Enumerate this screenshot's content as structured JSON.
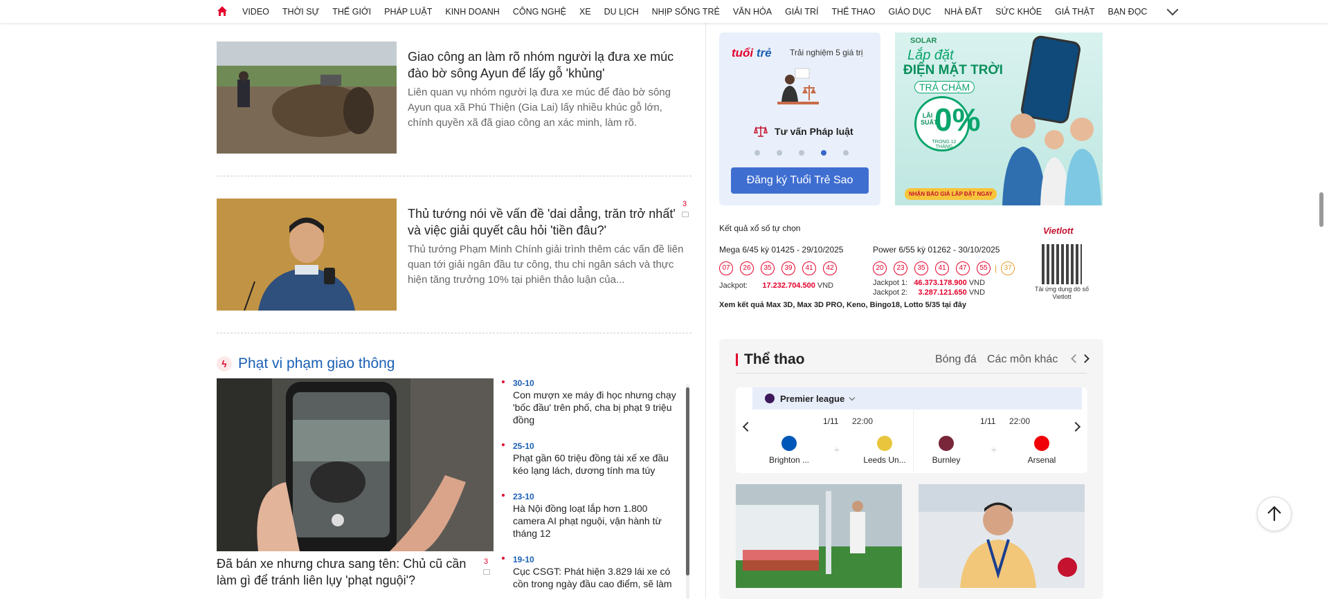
{
  "nav": {
    "items": [
      "VIDEO",
      "THỜI SỰ",
      "THẾ GIỚI",
      "PHÁP LUẬT",
      "KINH DOANH",
      "CÔNG NGHỆ",
      "XE",
      "DU LỊCH",
      "NHỊP SỐNG TRẺ",
      "VĂN HÓA",
      "GIẢI TRÍ",
      "THỂ THAO",
      "GIÁO DỤC",
      "NHÀ ĐẤT",
      "SỨC KHỎE",
      "GIẢ THẬT",
      "BẠN ĐỌC"
    ]
  },
  "articles": [
    {
      "title": "Giao công an làm rõ nhóm người lạ đưa xe múc đào bờ sông Ayun để lấy gỗ 'khủng'",
      "sapo": "Liên quan vụ nhóm người lạ đưa xe múc để đào bờ sông Ayun qua xã Phú Thiện (Gia Lai) lấy nhiều khúc gỗ lớn, chính quyền xã đã giao công an xác minh, làm rõ."
    },
    {
      "title": "Thủ tướng nói về vấn đề 'dai dẳng, trăn trở nhất' và việc giải quyết câu hỏi 'tiền đâu?'",
      "sapo": "Thủ tướng Phạm Minh Chính giải trình thêm các vấn đề liên quan tới giải ngân đầu tư công, thu chi ngân sách và thực hiện tăng trưởng 10% tại phiên thảo luận của...",
      "comments": "3"
    }
  ],
  "traffic": {
    "section_title": "Phạt vi phạm giao thông",
    "feature_title": "Đã bán xe nhưng chưa sang tên: Chủ cũ cần làm gì để tránh liên lụy 'phạt nguội'?",
    "feature_comments": "3",
    "list": [
      {
        "date": "30-10",
        "text": "Con mượn xe máy đi học nhưng chạy 'bốc đầu' trên phố, cha bị phạt 9 triệu đồng"
      },
      {
        "date": "25-10",
        "text": "Phạt gần 60 triệu đồng tài xế xe đầu kéo lạng lách, dương tính ma túy"
      },
      {
        "date": "23-10",
        "text": "Hà Nội đồng loạt lắp hơn 1.800 camera AI phạt nguội, vận hành từ tháng 12"
      },
      {
        "date": "19-10",
        "text": "Cục CSGT: Phát hiện 3.829 lái xe có cồn trong ngày đầu cao điểm, sẽ làm"
      }
    ]
  },
  "promo": {
    "logo_a": "tuổi",
    "logo_b": "trẻ",
    "tagline": "Trải nghiệm 5 giá trị",
    "service": "Tư vấn Pháp luật",
    "button": "Đăng ký Tuổi Trẻ Sao",
    "active_dot": 3
  },
  "ad": {
    "brand": "SOLAR",
    "line1": "Lắp đặt",
    "line2": "ĐIỆN MẶT TRỜI",
    "line3": "TRẢ CHẬM",
    "rate_label": "LÃI SUẤT",
    "rate": "0%",
    "rate_sub": "TRONG 12 THÁNG",
    "cta": "NHẬN BÁO GIÁ LẮP ĐẶT NGAY"
  },
  "lottery": {
    "header": "Kết quả xổ số tự chọn",
    "logo": "Vietlott",
    "mega": {
      "title": "Mega 6/45 kỳ 01425 - 29/10/2025",
      "balls": [
        "07",
        "26",
        "35",
        "39",
        "41",
        "42"
      ],
      "jackpot_label": "Jackpot:",
      "jackpot": "17.232.704.500",
      "unit": "VND"
    },
    "power": {
      "title": "Power 6/55 kỳ 01262 - 30/10/2025",
      "balls": [
        "20",
        "23",
        "35",
        "41",
        "47",
        "55"
      ],
      "extra": "37",
      "sep": "|",
      "jp1_label": "Jackpot 1:",
      "jp1": "46.373.178.900",
      "jp2_label": "Jackpot 2:",
      "jp2": "3.287.121.650",
      "unit": "VND"
    },
    "qr_label": "Tải ứng dụng dò số Vietlott",
    "more": "Xem kết quả Max 3D, Max 3D PRO, Keno, Bingo18, Lotto 5/35 tại đây"
  },
  "sport": {
    "title": "Thể thao",
    "tab1": "Bóng đá",
    "tab2": "Các môn khác",
    "league": "Premier league",
    "matches": [
      {
        "date": "1/11",
        "time": "22:00",
        "home": "Brighton ...",
        "away": "Leeds Un...",
        "vs": "÷"
      },
      {
        "date": "1/11",
        "time": "22:00",
        "home": "Burnley",
        "away": "Arsenal",
        "vs": "÷"
      }
    ]
  },
  "colors": {
    "accent": "#e4002b",
    "link": "#1a5fb4",
    "button": "#3f6ed1"
  }
}
